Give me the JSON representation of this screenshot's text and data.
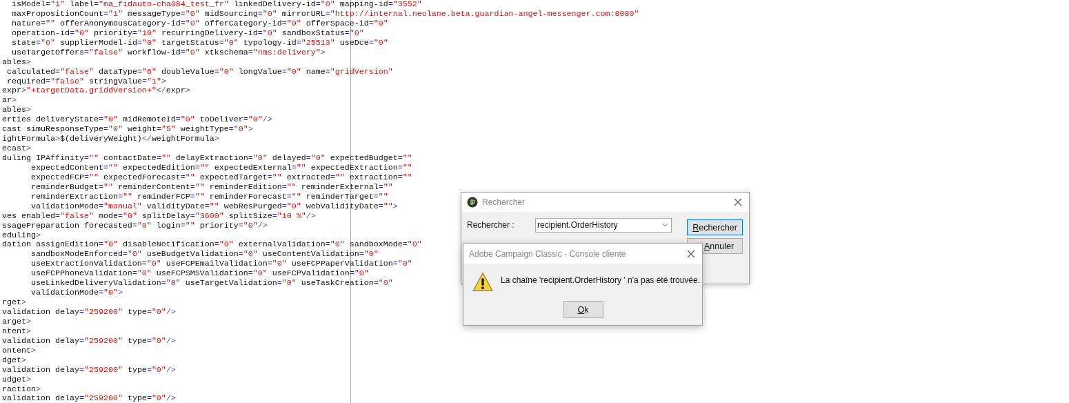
{
  "editor": {
    "lines": [
      "  isModel=\"1\" label=\"ma_fidauto-cha084_test_fr\" linkedDelivery-id=\"0\" mapping-id=\"3552\"",
      "  maxPropositionCount=\"1\" messageType=\"0\" midSourcing=\"0\" mirrorURL=\"http://internal.neolane.beta.guardian-angel-messenger.com:8080\"",
      "  nature=\"\" offerAnonymousCategory-id=\"0\" offerCategory-id=\"0\" offerSpace-id=\"0\"",
      "  operation-id=\"0\" priority=\"10\" recurringDelivery-id=\"0\" sandboxStatus=\"0\"",
      "  state=\"0\" supplierModel-id=\"0\" targetStatus=\"0\" typology-id=\"25513\" useDce=\"0\"",
      "  useTargetOffers=\"false\" workflow-id=\"0\" xtkschema=\"nms:delivery\">",
      "ables>",
      " calculated=\"false\" dataType=\"6\" doubleValue=\"0\" longValue=\"0\" name=\"gridVersion\"",
      " required=\"false\" stringValue=\"1\">",
      "expr>\"+targetData.griddVersion+\"</expr>",
      "ar>",
      "ables>",
      "erties deliveryState=\"0\" midRemoteId=\"0\" toDeliver=\"0\"/>",
      "cast simuResponseType=\"0\" weight=\"5\" weightType=\"0\">",
      "ightFormula>$(deliveryWeight)</weightFormula>",
      "ecast>",
      "duling IPAffinity=\"\" contactDate=\"\" delayExtraction=\"0\" delayed=\"0\" expectedBudget=\"\"",
      "      expectedContent=\"\" expectedEdition=\"\" expectedExternal=\"\" expectedExtraction=\"\"",
      "      expectedFCP=\"\" expectedForecast=\"\" expectedTarget=\"\" extracted=\"\" extraction=\"\"",
      "      reminderBudget=\"\" reminderContent=\"\" reminderEdition=\"\" reminderExternal=\"\"",
      "      reminderExtraction=\"\" reminderFCP=\"\" reminderForecast=\"\" reminderTarget=\"\"",
      "      validationMode=\"manual\" validityDate=\"\" webResPurged=\"0\" webValidityDate=\"\">",
      "ves enabled=\"false\" mode=\"0\" splitDelay=\"3600\" splitSize=\"10 %\"/>",
      "ssagePreparation forecasted=\"0\" login=\"\" priority=\"0\"/>",
      "eduling>",
      "dation assignEdition=\"0\" disableNotification=\"0\" externalValidation=\"0\" sandboxMode=\"0\"",
      "      sandboxModeEnforced=\"0\" useBudgetValidation=\"0\" useContentValidation=\"0\"",
      "      useExtractionValidation=\"0\" useFCPEmailValidation=\"0\" useFCPPaperValidation=\"0\"",
      "      useFCPPhoneValidation=\"0\" useFCPSMSValidation=\"0\" useFCPValidation=\"0\"",
      "      useLinkedDeliveryValidation=\"0\" useTargetValidation=\"0\" useTaskCreation=\"0\"",
      "      validationMode=\"0\">",
      "rget>",
      "validation delay=\"259200\" type=\"0\"/>",
      "arget>",
      "ntent>",
      "validation delay=\"259200\" type=\"0\"/>",
      "ontent>",
      "dget>",
      "validation delay=\"259200\" type=\"0\"/>",
      "udget>",
      "raction>",
      "validation delay=\"259200\" type=\"0\"/>"
    ]
  },
  "find_dialog": {
    "title": "Rechercher",
    "search_label": "Rechercher :",
    "search_value": "recipient.OrderHistory",
    "buttons": [
      {
        "label": "Rechercher",
        "focused": true
      },
      {
        "label": "Annuler",
        "focused": false
      }
    ]
  },
  "message_dialog": {
    "title": "Adobe Campaign Classic - Console cliente",
    "kind": "warning",
    "message": "La chaîne 'recipient.OrderHistory ' n'a pas été trouvée.",
    "buttons": [
      {
        "label": "Ok"
      }
    ]
  }
}
